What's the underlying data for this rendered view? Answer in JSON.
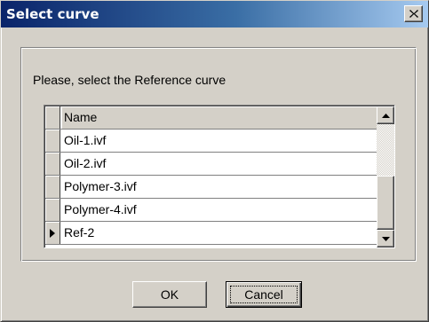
{
  "window": {
    "title": "Select curve",
    "icons": {
      "close": "close-icon"
    }
  },
  "dialog": {
    "prompt": "Please, select the Reference curve",
    "grid": {
      "column_header": "Name",
      "rows": [
        {
          "name": "Oil-1.ivf",
          "current": false
        },
        {
          "name": "Oil-2.ivf",
          "current": false
        },
        {
          "name": "Polymer-3.ivf",
          "current": false
        },
        {
          "name": "Polymer-4.ivf",
          "current": false
        },
        {
          "name": "Ref-2",
          "current": true
        }
      ],
      "icons": {
        "current_row": "row-pointer-icon",
        "scroll_up": "arrow-up-icon",
        "scroll_down": "arrow-down-icon"
      }
    },
    "buttons": {
      "ok": "OK",
      "cancel": "Cancel"
    }
  }
}
